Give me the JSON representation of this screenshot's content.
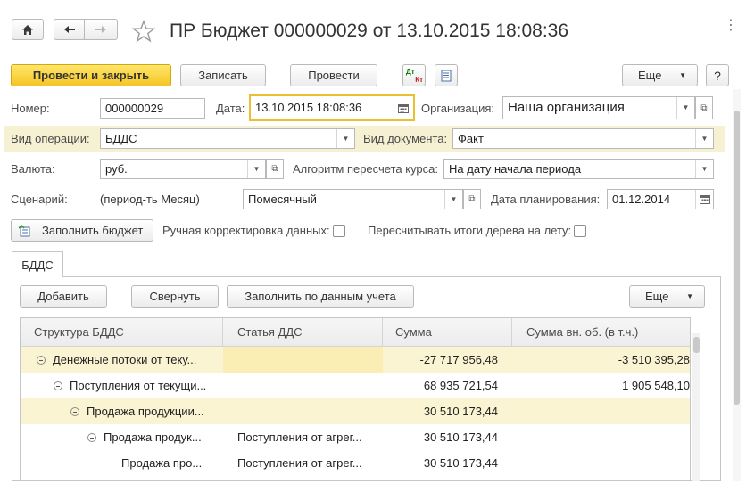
{
  "window": {
    "title": "ПР Бюджет 000000029 от 13.10.2015 18:08:36"
  },
  "nav": {
    "home_icon": "home-icon",
    "back_icon": "arrow-left-icon",
    "forward_icon": "arrow-right-icon",
    "favorite_icon": "star-icon"
  },
  "toolbar": {
    "post_close_label": "Провести и закрыть",
    "save_label": "Записать",
    "post_label": "Провести",
    "dtkt_top": "Дт",
    "dtkt_bottom": "Кт",
    "more_label": "Еще",
    "help_label": "?"
  },
  "form": {
    "number_label": "Номер:",
    "number_value": "000000029",
    "date_label": "Дата:",
    "date_value": "13.10.2015 18:08:36",
    "org_label": "Организация:",
    "org_value": "Наша организация",
    "op_type_label": "Вид операции:",
    "op_type_value": "БДДС",
    "doc_type_label": "Вид документа:",
    "doc_type_value": "Факт",
    "currency_label": "Валюта:",
    "currency_value": "руб.",
    "algo_label": "Алгоритм пересчета курса:",
    "algo_value": "На дату начала периода",
    "scenario_label": "Сценарий:",
    "scenario_period": "(период-ть Месяц)",
    "scenario_value": "Помесячный",
    "plan_date_label": "Дата планирования:",
    "plan_date_value": "01.12.2014",
    "fill_budget_label": "Заполнить бюджет",
    "manual_label": "Ручная корректировка данных:",
    "recalc_label": "Пересчитывать итоги дерева на лету:"
  },
  "tab": {
    "label": "БДДС",
    "add_label": "Добавить",
    "collapse_label": "Свернуть",
    "fill_actual_label": "Заполнить по данным учета",
    "more_label": "Еще"
  },
  "table": {
    "columns": [
      "Структура БДДС",
      "Статья ДДС",
      "Сумма",
      "Сумма вн. об. (в т.ч.)"
    ],
    "rows": [
      {
        "name": "Денежные потоки от теку...",
        "article": "",
        "sum": "-27 717 956,48",
        "internal": "-3 510 395,28",
        "level": 0,
        "toggle": true
      },
      {
        "name": "Поступления от текущи...",
        "article": "",
        "sum": "68 935 721,54",
        "internal": "1 905 548,10",
        "level": 1,
        "toggle": true
      },
      {
        "name": "Продажа продукции...",
        "article": "",
        "sum": "30 510 173,44",
        "internal": "",
        "level": 2,
        "toggle": true
      },
      {
        "name": "Продажа продук...",
        "article": "Поступления от агрег...",
        "sum": "30 510 173,44",
        "internal": "",
        "level": 3,
        "toggle": true
      },
      {
        "name": "Продажа про...",
        "article": "Поступления от агрег...",
        "sum": "30 510 173,44",
        "internal": "",
        "level": 4,
        "toggle": false
      }
    ]
  }
}
